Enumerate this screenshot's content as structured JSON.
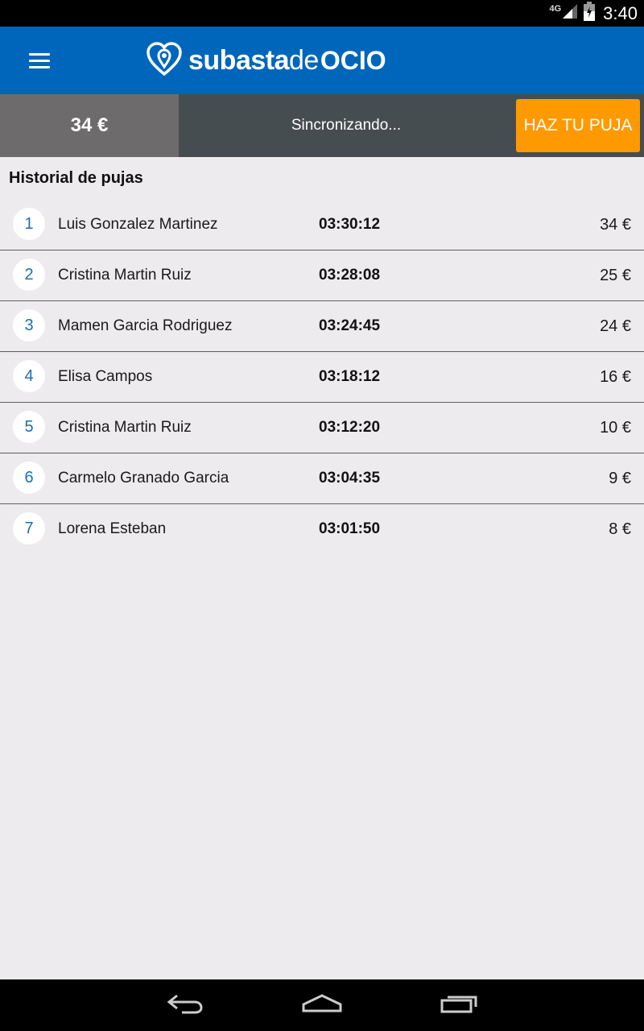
{
  "status_bar": {
    "network": "4G",
    "time": "3:40"
  },
  "app_bar": {
    "logo": {
      "part1": "subasta",
      "part2": "de",
      "part3": "OCIO"
    }
  },
  "bid_bar": {
    "current_price": "34 €",
    "status": "Sincronizando...",
    "bid_button_label": "HAZ TU PUJA"
  },
  "history": {
    "title": "Historial de pujas",
    "rows": [
      {
        "rank": "1",
        "name": "Luis Gonzalez Martinez",
        "time": "03:30:12",
        "amount": "34 €"
      },
      {
        "rank": "2",
        "name": "Cristina Martin Ruiz",
        "time": "03:28:08",
        "amount": "25 €"
      },
      {
        "rank": "3",
        "name": "Mamen Garcia Rodriguez",
        "time": "03:24:45",
        "amount": "24 €"
      },
      {
        "rank": "4",
        "name": "Elisa Campos",
        "time": "03:18:12",
        "amount": "16 €"
      },
      {
        "rank": "5",
        "name": "Cristina Martin Ruiz",
        "time": "03:12:20",
        "amount": "10 €"
      },
      {
        "rank": "6",
        "name": "Carmelo Granado Garcia",
        "time": "03:04:35",
        "amount": "9 €"
      },
      {
        "rank": "7",
        "name": "Lorena Esteban",
        "time": "03:01:50",
        "amount": "8 €"
      }
    ]
  },
  "colors": {
    "app_bar": "#0066bb",
    "bid_button": "#ff9900",
    "price_box": "#6e6b6d",
    "bid_bar": "#454d50",
    "rank_text": "#1f6db3",
    "background": "#eeebee"
  },
  "icons": {
    "menu": "hamburger-menu-icon",
    "logo": "heart-pin-icon",
    "signal": "signal-icon",
    "battery": "battery-icon",
    "back": "back-icon",
    "home": "home-icon",
    "recents": "recents-icon"
  }
}
